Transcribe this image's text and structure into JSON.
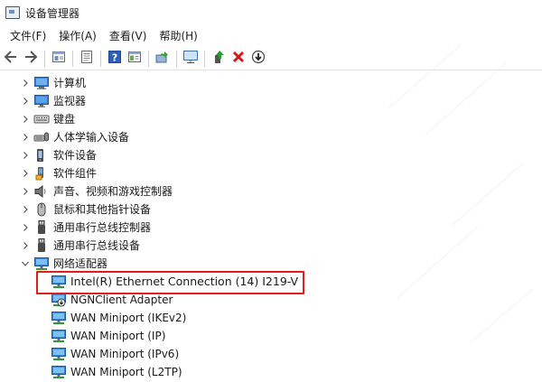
{
  "window": {
    "title": "设备管理器"
  },
  "menu": [
    "文件(F)",
    "操作(A)",
    "查看(V)",
    "帮助(H)"
  ],
  "toolbar": [
    "back-arrow-icon",
    "forward-arrow-icon",
    "sep",
    "properties-icon",
    "sep",
    "details-icon",
    "sep",
    "help-icon",
    "view-icon",
    "sep",
    "update-driver-icon",
    "sep",
    "monitor-scan-icon",
    "sep",
    "enable-device-icon",
    "uninstall-device-icon",
    "download-arrow-icon"
  ],
  "colors": {
    "highlight": "#e01e1e",
    "selection": "#cde8fb",
    "monitor": "#3a7fd0"
  },
  "tree": [
    {
      "label": "计算机",
      "icon": "computer-icon",
      "level": 1,
      "expanded": false
    },
    {
      "label": "监视器",
      "icon": "monitor-icon",
      "level": 1,
      "expanded": false
    },
    {
      "label": "键盘",
      "icon": "keyboard-icon",
      "level": 1,
      "expanded": false
    },
    {
      "label": "人体学输入设备",
      "icon": "hid-icon",
      "level": 1,
      "expanded": false
    },
    {
      "label": "软件设备",
      "icon": "software-device-icon",
      "level": 1,
      "expanded": false
    },
    {
      "label": "软件组件",
      "icon": "software-component-icon",
      "level": 1,
      "expanded": false
    },
    {
      "label": "声音、视频和游戏控制器",
      "icon": "speaker-icon",
      "level": 1,
      "expanded": false
    },
    {
      "label": "鼠标和其他指针设备",
      "icon": "mouse-icon",
      "level": 1,
      "expanded": false
    },
    {
      "label": "通用串行总线控制器",
      "icon": "usb-icon",
      "level": 1,
      "expanded": false
    },
    {
      "label": "通用串行总线设备",
      "icon": "usb-icon",
      "level": 1,
      "expanded": false
    },
    {
      "label": "网络适配器",
      "icon": "network-adapter-icon",
      "level": 1,
      "expanded": true
    },
    {
      "label": "Intel(R) Ethernet Connection (14) I219-V",
      "icon": "network-adapter-icon",
      "level": 2,
      "highlighted": true
    },
    {
      "label": "NGNClient Adapter",
      "icon": "network-adapter-download-icon",
      "level": 2
    },
    {
      "label": "WAN Miniport (IKEv2)",
      "icon": "network-adapter-icon",
      "level": 2
    },
    {
      "label": "WAN Miniport (IP)",
      "icon": "network-adapter-icon",
      "level": 2
    },
    {
      "label": "WAN Miniport (IPv6)",
      "icon": "network-adapter-icon",
      "level": 2
    },
    {
      "label": "WAN Miniport (L2TP)",
      "icon": "network-adapter-icon",
      "level": 2
    }
  ]
}
